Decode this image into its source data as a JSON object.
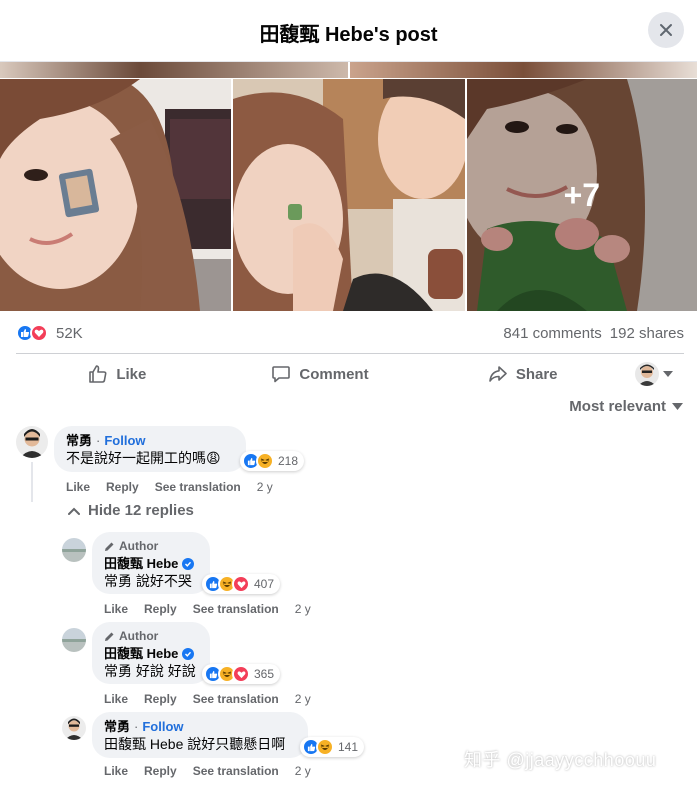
{
  "header": {
    "title": "田馥甄 Hebe's post"
  },
  "photos": {
    "more_count": "+7"
  },
  "stats": {
    "reaction_count": "52K",
    "comments": "841 comments",
    "shares": "192 shares"
  },
  "actions": {
    "like": "Like",
    "comment": "Comment",
    "share": "Share"
  },
  "sort": {
    "label": "Most relevant"
  },
  "colors": {
    "facebook_blue": "#1877f2",
    "love_red": "#f33e58",
    "haha_yellow": "#f7b125",
    "text_secondary": "#65676b",
    "bubble_bg": "#f0f2f5"
  },
  "comments": [
    {
      "name": "常勇",
      "follow": "Follow",
      "text": "不是說好一起開工的嗎😩",
      "reactions": "218",
      "like": "Like",
      "reply": "Reply",
      "translate": "See translation",
      "age": "2 y"
    }
  ],
  "hide_replies": "Hide 12 replies",
  "replies": [
    {
      "author_tag": "Author",
      "name": "田馥甄 Hebe",
      "text": "常勇 說好不哭",
      "reactions": "407",
      "like": "Like",
      "reply": "Reply",
      "translate": "See translation",
      "age": "2 y"
    },
    {
      "author_tag": "Author",
      "name": "田馥甄 Hebe",
      "text": "常勇 好說 好說",
      "reactions": "365",
      "like": "Like",
      "reply": "Reply",
      "translate": "See translation",
      "age": "2 y"
    },
    {
      "name": "常勇",
      "follow": "Follow",
      "text": "田馥甄 Hebe 說好只聽懸日啊",
      "reactions": "141",
      "like": "Like",
      "reply": "Reply",
      "translate": "See translation",
      "age": "2 y"
    }
  ],
  "watermark": "知乎 @jjaayycchhoouu"
}
